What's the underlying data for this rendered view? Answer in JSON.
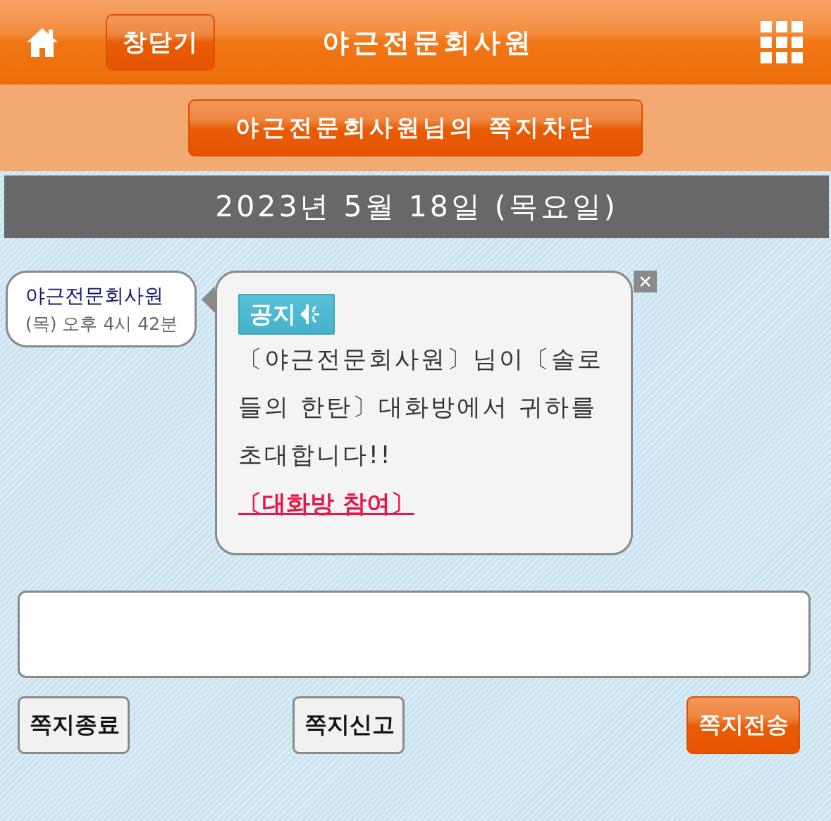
{
  "header": {
    "close_button": "창닫기",
    "title": "야근전문회사원"
  },
  "block_button": "야근전문회사원님의 쪽지차단",
  "date_bar": "2023년 5월 18일 (목요일)",
  "messages": [
    {
      "sender": "야근전문회사원",
      "time": "(목) 오후 4시 42분",
      "badge": "공지",
      "text": "〔야근전문회사원〕님이〔솔로들의 한탄〕대화방에서 귀하를 초대합니다!!",
      "link": "〔대화방 참여〕"
    }
  ],
  "buttons": [
    {
      "label": "쪽지종료",
      "kind": "plain"
    },
    {
      "label": "쪽지신고",
      "kind": "plain"
    },
    {
      "label": "쪽지전송",
      "kind": "primary"
    }
  ]
}
